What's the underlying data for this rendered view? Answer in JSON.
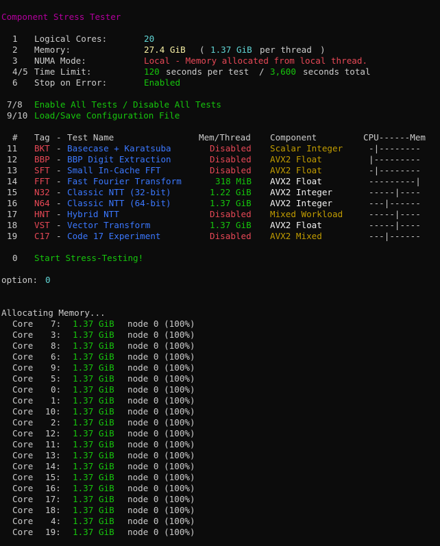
{
  "title": "Component Stress Tester",
  "settings": [
    {
      "num": "1",
      "label": "Logical Cores:",
      "value": "20"
    },
    {
      "num": "2",
      "label": "Memory:",
      "value_main": "27.4 GiB",
      "open": "(",
      "value_sub": "1.37 GiB",
      "suffix": "per thread",
      "close": ")"
    },
    {
      "num": "3",
      "label": "NUMA Mode:",
      "value": "Local - Memory allocated from local thread."
    },
    {
      "num": "4/5",
      "label": "Time Limit:",
      "per_test_value": "120",
      "per_test_text": "seconds per test",
      "sep": "/",
      "total_value": "3,600",
      "total_text": "seconds total"
    },
    {
      "num": "6",
      "label": "Stop on Error:",
      "value": "Enabled"
    }
  ],
  "actions": [
    {
      "num": "7/8",
      "label": "Enable All Tests / Disable All Tests"
    },
    {
      "num": "9/10",
      "label": "Load/Save Configuration File"
    }
  ],
  "table": {
    "headers": {
      "num": "#",
      "tag": "Tag",
      "dash": "-",
      "name": "Test Name",
      "mem": "Mem/Thread",
      "component": "Component",
      "cpumem": "CPU------Mem"
    },
    "rows": [
      {
        "num": "11",
        "tag": "BKT",
        "name": "Basecase + Karatsuba",
        "mem": "Disabled",
        "component": "Scalar Integer",
        "bar": "-|--------"
      },
      {
        "num": "12",
        "tag": "BBP",
        "name": "BBP Digit Extraction",
        "mem": "Disabled",
        "component": "AVX2 Float",
        "bar": "|---------"
      },
      {
        "num": "13",
        "tag": "SFT",
        "name": "Small In-Cache FFT",
        "mem": "Disabled",
        "component": "AVX2 Float",
        "bar": "-|--------"
      },
      {
        "num": "14",
        "tag": "FFT",
        "name": "Fast Fourier Transform",
        "mem": "318 MiB",
        "component": "AVX2 Float",
        "bar": "---------|"
      },
      {
        "num": "15",
        "tag": "N32",
        "name": "Classic NTT (32-bit)",
        "mem": "1.22 GiB",
        "component": "AVX2 Integer",
        "bar": "-----|----"
      },
      {
        "num": "16",
        "tag": "N64",
        "name": "Classic NTT (64-bit)",
        "mem": "1.37 GiB",
        "component": "AVX2 Integer",
        "bar": "---|------"
      },
      {
        "num": "17",
        "tag": "HNT",
        "name": "Hybrid NTT",
        "mem": "Disabled",
        "component": "Mixed Workload",
        "bar": "-----|----"
      },
      {
        "num": "18",
        "tag": "VST",
        "name": "Vector Transform",
        "mem": "1.37 GiB",
        "component": "AVX2 Float",
        "bar": "-----|----"
      },
      {
        "num": "19",
        "tag": "C17",
        "name": "Code 17 Experiment",
        "mem": "Disabled",
        "component": "AVX2 Mixed",
        "bar": "---|------"
      }
    ]
  },
  "start": {
    "num": "0",
    "label": "Start Stress-Testing!"
  },
  "option": {
    "prompt": "option:",
    "value": "0"
  },
  "alloc": {
    "title": "Allocating Memory...",
    "core_label": "Core",
    "size": "1.37 GiB",
    "node": "node 0 (100%)",
    "cores": [
      "7:",
      "3:",
      "8:",
      "6:",
      "9:",
      "5:",
      "0:",
      "1:",
      "10:",
      "2:",
      "12:",
      "11:",
      "13:",
      "14:",
      "15:",
      "16:",
      "17:",
      "18:",
      "4:",
      "19:"
    ]
  },
  "colors": {
    "background": "#0c0c0c",
    "text": "#cccccc",
    "title": "#b4009e",
    "cyan": "#61d6d6",
    "yellow": "#f9f1a5",
    "green": "#16c60c",
    "red": "#e74856",
    "orange": "#c19c00",
    "blue": "#3b78ff"
  }
}
